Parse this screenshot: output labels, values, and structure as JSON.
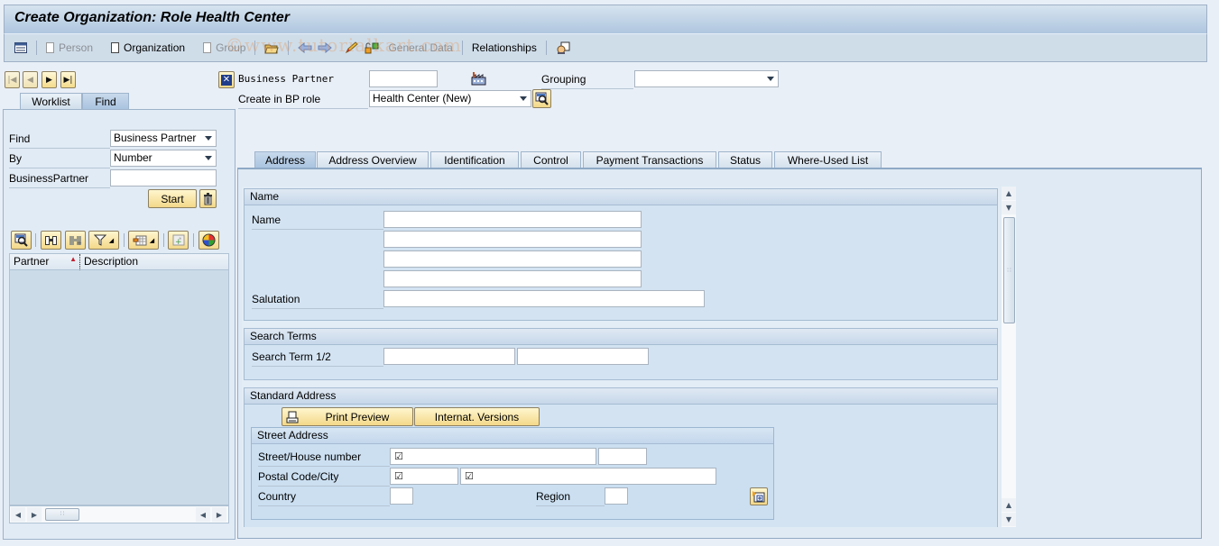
{
  "window": {
    "title": "Create Organization: Role Health Center"
  },
  "toolbar": {
    "items": [
      {
        "label": "Person",
        "enabled": false
      },
      {
        "label": "Organization",
        "enabled": true
      },
      {
        "label": "Group",
        "enabled": false
      },
      {
        "label": "General Data",
        "enabled": false
      },
      {
        "label": "Relationships",
        "enabled": true
      }
    ],
    "icons": [
      "list-icon",
      "open-folder-icon",
      "back-arrow-icon",
      "forward-arrow-icon",
      "edit-pencil-icon",
      "lock-switch-icon",
      "portrait-icon"
    ],
    "watermark": "©www.tutorialkart.com"
  },
  "locator": {
    "tabs": [
      {
        "label": "Worklist",
        "active": false
      },
      {
        "label": "Find",
        "active": true
      }
    ],
    "find_label": "Find",
    "find_value": "Business Partner",
    "by_label": "By",
    "by_value": "Number",
    "bp_label": "BusinessPartner",
    "bp_value": "",
    "start_label": "Start",
    "columns": [
      "Partner",
      "Description"
    ],
    "rows": []
  },
  "header": {
    "bp_label": "Business Partner",
    "bp_value": "",
    "grouping_label": "Grouping",
    "grouping_value": "",
    "role_label": "Create in BP role",
    "role_value": "Health Center (New)"
  },
  "tabs": [
    {
      "label": "Address",
      "active": true
    },
    {
      "label": "Address Overview",
      "active": false
    },
    {
      "label": "Identification",
      "active": false
    },
    {
      "label": "Control",
      "active": false
    },
    {
      "label": "Payment Transactions",
      "active": false
    },
    {
      "label": "Status",
      "active": false
    },
    {
      "label": "Where-Used List",
      "active": false
    }
  ],
  "name_group": {
    "title": "Name",
    "name_label": "Name",
    "name_lines": [
      "",
      "",
      "",
      ""
    ],
    "salutation_label": "Salutation",
    "salutation_value": ""
  },
  "search_group": {
    "title": "Search Terms",
    "label": "Search Term 1/2",
    "term1": "",
    "term2": ""
  },
  "address_group": {
    "title": "Standard Address",
    "print_preview_label": "Print Preview",
    "internat_versions_label": "Internat. Versions",
    "street_title": "Street Address",
    "street_label": "Street/House number",
    "street_value": "☑",
    "house_value": "",
    "postal_label": "Postal Code/City",
    "postal_value": "☑",
    "city_value": "☑",
    "country_label": "Country",
    "country_value": "",
    "region_label": "Region",
    "region_value": ""
  }
}
